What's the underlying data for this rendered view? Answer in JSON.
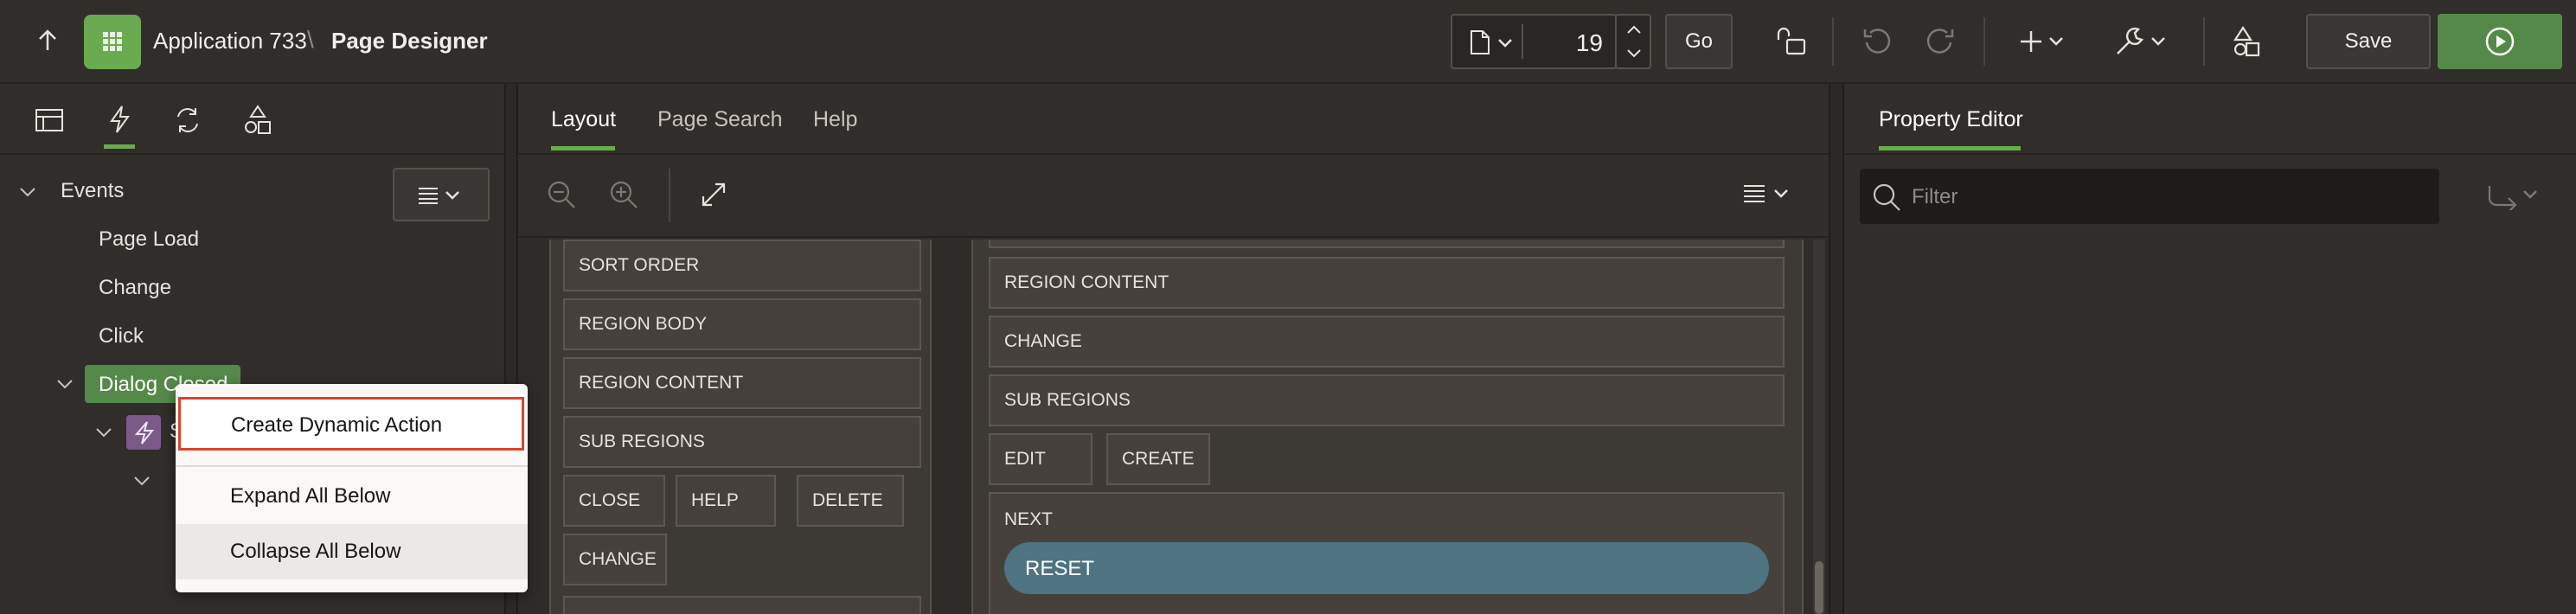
{
  "header": {
    "app_name": "Application 733",
    "breadcrumb_sep": "\\",
    "page_title": "Page Designer",
    "page_number": "19",
    "go_label": "Go",
    "save_label": "Save",
    "accent_green": "#6aaa50",
    "icons": [
      "up-arrow-icon",
      "app-grid-icon",
      "page-icon",
      "lock-icon",
      "undo-icon",
      "redo-icon",
      "plus-icon",
      "wrench-icon",
      "shared-components-icon",
      "run-icon"
    ]
  },
  "left_panel": {
    "tab_icons": [
      "rendering-tab-icon",
      "dynamic-actions-tab-icon",
      "processing-tab-icon",
      "shared-components-tab-icon"
    ],
    "tree": {
      "root": "Events",
      "items": [
        "Page Load",
        "Change",
        "Click"
      ],
      "selected": "Dialog Closed",
      "child_partial": "S"
    }
  },
  "center": {
    "tabs": [
      "Layout",
      "Page Search",
      "Help"
    ],
    "active_tab": "Layout",
    "left_column": [
      "SORT ORDER",
      "REGION BODY",
      "REGION CONTENT",
      "SUB REGIONS"
    ],
    "left_buttons_row": [
      "CLOSE",
      "HELP",
      "DELETE"
    ],
    "left_buttons_row2": [
      "CHANGE"
    ],
    "right_column": [
      "REGION CONTENT",
      "CHANGE",
      "SUB REGIONS"
    ],
    "right_buttons_row": [
      "EDIT",
      "CREATE"
    ],
    "next_label": "NEXT",
    "reset_label": "RESET",
    "reset_color": "#4e7381"
  },
  "right_panel": {
    "title": "Property Editor",
    "filter_placeholder": "Filter"
  },
  "context_menu": {
    "items": [
      "Create Dynamic Action",
      "Expand All Below",
      "Collapse All Below"
    ],
    "highlighted": "Create Dynamic Action",
    "highlight_border": "#d9432f"
  }
}
